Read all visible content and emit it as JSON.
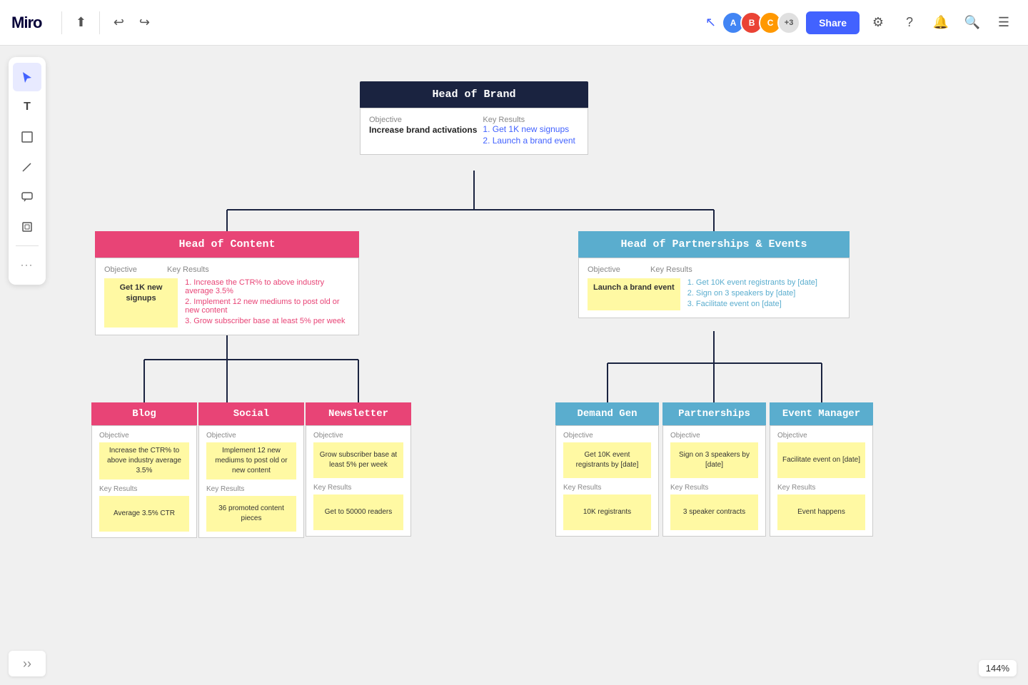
{
  "app": {
    "name": "Miro",
    "zoom": "144%"
  },
  "topbar": {
    "logo": "miro",
    "undo_label": "↩",
    "redo_label": "↪",
    "share_label": "Share",
    "avatars": [
      {
        "initials": "A",
        "color": "#4285f4"
      },
      {
        "initials": "B",
        "color": "#ea4335"
      },
      {
        "initials": "C",
        "color": "#ff9800"
      }
    ],
    "avatar_count": "+3"
  },
  "toolbar": {
    "tools": [
      "cursor",
      "text",
      "sticky",
      "pen",
      "comment",
      "frame",
      "more"
    ]
  },
  "brand_node": {
    "title": "Head of Brand",
    "objective_label": "Objective",
    "key_results_label": "Key Results",
    "objective": "Increase brand activations",
    "key_results": [
      "1. Get 1K new signups",
      "2. Launch a brand event"
    ]
  },
  "content_node": {
    "title": "Head of Content",
    "objective_label": "Objective",
    "key_results_label": "Key Results",
    "objective": "Get 1K new signups",
    "key_results": [
      "1. Increase the CTR% to above industry average 3.5%",
      "2. Implement 12 new mediums to post old or new content",
      "3. Grow subscriber base at least 5% per week"
    ]
  },
  "partnerships_node": {
    "title": "Head of Partnerships & Events",
    "objective_label": "Objective",
    "key_results_label": "Key Results",
    "objective": "Launch a brand event",
    "key_results": [
      "1. Get 10K event registrants by [date]",
      "2. Sign on 3 speakers by [date]",
      "3. Facilitate event on [date]"
    ]
  },
  "blog_node": {
    "title": "Blog",
    "objective_label": "Objective",
    "key_results_label": "Key Results",
    "objective": "Increase the CTR% to above industry average 3.5%",
    "key_result": "Average 3.5% CTR"
  },
  "social_node": {
    "title": "Social",
    "objective_label": "Objective",
    "key_results_label": "Key Results",
    "objective": "Implement 12 new mediums to post old or new content",
    "key_result": "36 promoted content pieces"
  },
  "newsletter_node": {
    "title": "Newsletter",
    "objective_label": "Objective",
    "key_results_label": "Key Results",
    "objective": "Grow subscriber base at least 5% per week",
    "key_result": "Get to 50000 readers"
  },
  "demandgen_node": {
    "title": "Demand Gen",
    "objective_label": "Objective",
    "key_results_label": "Key Results",
    "objective": "Get 10K event registrants by [date]",
    "key_result": "10K registrants"
  },
  "partnerships_sub_node": {
    "title": "Partnerships",
    "objective_label": "Objective",
    "key_results_label": "Key Results",
    "objective": "Sign on 3 speakers by [date]",
    "key_result": "3 speaker contracts"
  },
  "eventmgr_node": {
    "title": "Event Manager",
    "objective_label": "Objective",
    "key_results_label": "Key Results",
    "objective": "Facilitate event on [date]",
    "key_result": "Event happens"
  }
}
